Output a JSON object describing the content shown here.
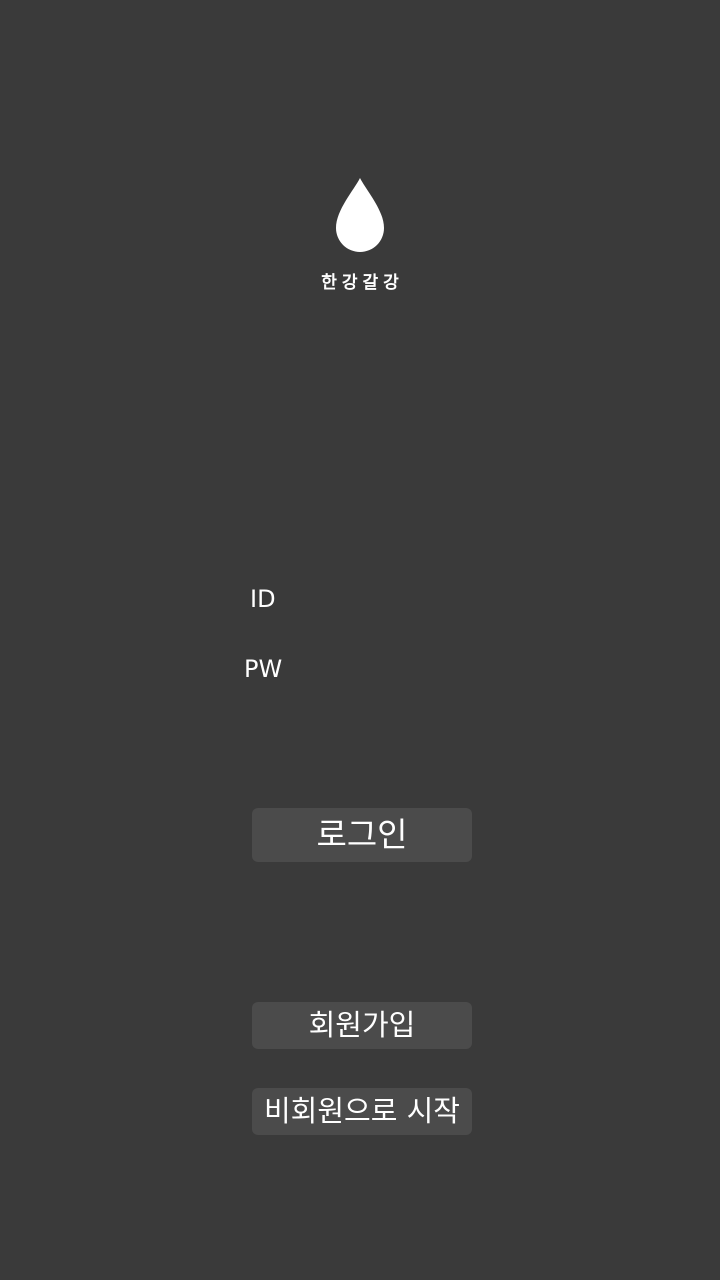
{
  "app": {
    "name": "한강갈강",
    "logo_icon": "water-drop-icon"
  },
  "form": {
    "id_label": "ID",
    "pw_label": "PW",
    "id_value": "",
    "pw_value": ""
  },
  "buttons": {
    "login": "로그인",
    "signup": "회원가입",
    "guest": "비회원으로 시작"
  },
  "colors": {
    "background": "#3a3a3a",
    "button": "#4b4b4b",
    "text": "#ffffff"
  }
}
